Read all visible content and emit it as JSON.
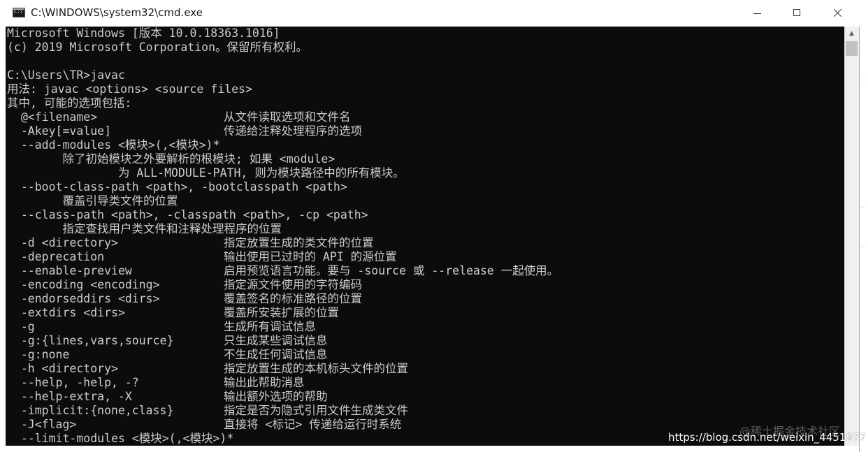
{
  "window": {
    "title": "C:\\WINDOWS\\system32\\cmd.exe",
    "icon": "cmd-icon",
    "controls": [
      "minimize-icon",
      "maximize-icon",
      "close-icon"
    ]
  },
  "console": {
    "lines": [
      {
        "a": "Microsoft Windows [版本 10.0.18363.1016]",
        "b": ""
      },
      {
        "a": "(c) 2019 Microsoft Corporation。保留所有权利。",
        "b": ""
      },
      {
        "a": "",
        "b": ""
      },
      {
        "a": "C:\\Users\\TR>javac",
        "b": ""
      },
      {
        "a": "用法: javac <options> <source files>",
        "b": ""
      },
      {
        "a": "其中, 可能的选项包括:",
        "b": ""
      },
      {
        "a": "  @<filename>",
        "b": "从文件读取选项和文件名"
      },
      {
        "a": "  -Akey[=value]",
        "b": "传递给注释处理程序的选项"
      },
      {
        "a": "  --add-modules <模块>(,<模块>)*",
        "b": ""
      },
      {
        "a": "        除了初始模块之外要解析的根模块; 如果 <module>",
        "b": ""
      },
      {
        "a": "                为 ALL-MODULE-PATH, 则为模块路径中的所有模块。",
        "b": ""
      },
      {
        "a": "  --boot-class-path <path>, -bootclasspath <path>",
        "b": ""
      },
      {
        "a": "        覆盖引导类文件的位置",
        "b": ""
      },
      {
        "a": "  --class-path <path>, -classpath <path>, -cp <path>",
        "b": ""
      },
      {
        "a": "        指定查找用户类文件和注释处理程序的位置",
        "b": ""
      },
      {
        "a": "  -d <directory>",
        "b": "指定放置生成的类文件的位置"
      },
      {
        "a": "  -deprecation",
        "b": "输出使用已过时的 API 的源位置"
      },
      {
        "a": "  --enable-preview",
        "b": "启用预览语言功能。要与 -source 或 --release 一起使用。"
      },
      {
        "a": "  -encoding <encoding>",
        "b": "指定源文件使用的字符编码"
      },
      {
        "a": "  -endorseddirs <dirs>",
        "b": "覆盖签名的标准路径的位置"
      },
      {
        "a": "  -extdirs <dirs>",
        "b": "覆盖所安装扩展的位置"
      },
      {
        "a": "  -g",
        "b": "生成所有调试信息"
      },
      {
        "a": "  -g:{lines,vars,source}",
        "b": "只生成某些调试信息"
      },
      {
        "a": "  -g:none",
        "b": "不生成任何调试信息"
      },
      {
        "a": "  -h <directory>",
        "b": "指定放置生成的本机标头文件的位置"
      },
      {
        "a": "  --help, -help, -?",
        "b": "输出此帮助消息"
      },
      {
        "a": "  --help-extra, -X",
        "b": "输出额外选项的帮助"
      },
      {
        "a": "  -implicit:{none,class}",
        "b": "指定是否为隐式引用文件生成类文件"
      },
      {
        "a": "  -J<flag>",
        "b": "直接将 <标记> 传递给运行时系统"
      },
      {
        "a": "  --limit-modules <模块>(,<模块>)*",
        "b": ""
      }
    ]
  },
  "watermark": {
    "brand": "@稀土掘金技术社区",
    "url": "https://blog.csdn.net/weixin_44519772"
  },
  "colors": {
    "console_bg": "#0c0c0c",
    "console_fg": "#cccccc",
    "titlebar_bg": "#ffffff"
  }
}
